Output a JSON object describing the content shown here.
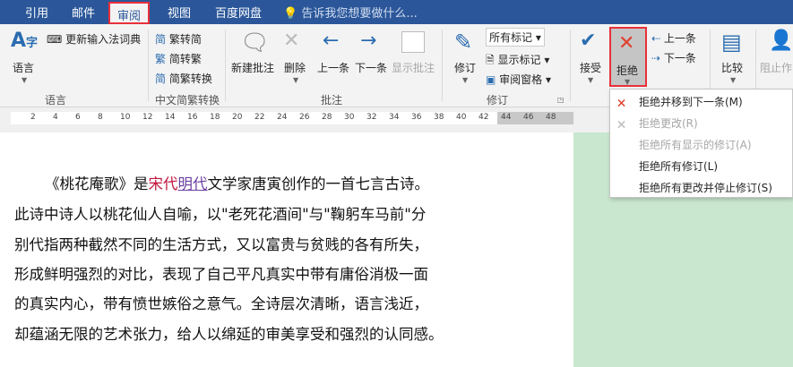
{
  "tabs": [
    "引用",
    "邮件",
    "审阅",
    "视图",
    "百度网盘"
  ],
  "tell_me": "告诉我您想要做什么...",
  "ribbon": {
    "language": {
      "btn": "语言",
      "update": "更新输入法词典",
      "group": "语言"
    },
    "chinese": {
      "t2s": "繁转简",
      "s2t": "简转繁",
      "convert": "简繁转换",
      "group": "中文简繁转换"
    },
    "comments": {
      "new": "新建批注",
      "delete": "删除",
      "prev": "上一条",
      "next": "下一条",
      "show": "显示批注",
      "group": "批注"
    },
    "tracking": {
      "track": "修订",
      "markup": "所有标记",
      "show_markup": "显示标记",
      "pane": "审阅窗格",
      "group": "修订"
    },
    "changes": {
      "accept": "接受",
      "reject": "拒绝",
      "prev": "上一条",
      "next": "下一条"
    },
    "compare": "比较",
    "block": "阻止作"
  },
  "ruler_ticks": [
    "2",
    "4",
    "6",
    "8",
    "10",
    "12",
    "14",
    "16",
    "18",
    "20",
    "22",
    "24",
    "26",
    "28",
    "30",
    "32",
    "34",
    "36",
    "38",
    "40",
    "42",
    "44",
    "46",
    "48"
  ],
  "menu": [
    {
      "label": "拒绝并移到下一条(M)",
      "enabled": true
    },
    {
      "label": "拒绝更改(R)",
      "enabled": false
    },
    {
      "label": "拒绝所有显示的修订(A)",
      "enabled": false
    },
    {
      "label": "拒绝所有修订(L)",
      "enabled": true
    },
    {
      "label": "拒绝所有更改并停止修订(S)",
      "enabled": true
    }
  ],
  "doc": {
    "l1a": "《桃花庵歌》是",
    "l1b": "宋代",
    "l1c": "明代",
    "l1d": "文学家唐寅创作的一首七言古诗。",
    "lines": [
      "此诗中诗人以桃花仙人自喻，以\"老死花酒间\"与\"鞠躬车马前\"分",
      "别代指两种截然不同的生活方式，又以富贵与贫贱的各有所失，",
      "形成鲜明强烈的对比，表现了自己平凡真实中带有庸俗消极一面",
      "的真实内心，带有愤世嫉俗之意气。全诗层次清晰，语言浅近，",
      "却蕴涵无限的艺术张力，给人以绵延的审美享受和强烈的认同感。"
    ]
  }
}
